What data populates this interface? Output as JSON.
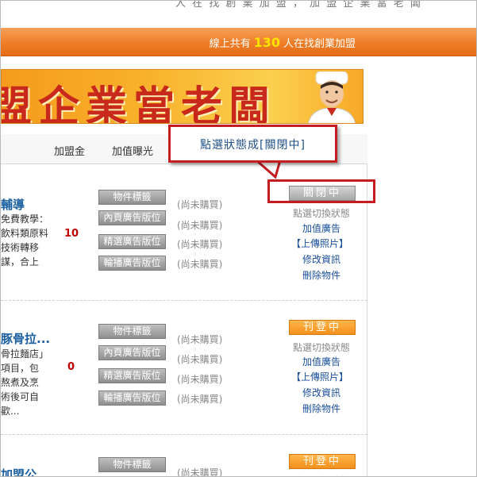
{
  "top_text": "人 在 找 創 業 加 盟 ， 加 盟 企 業 當 老 闆",
  "header": {
    "online_prefix": "線上共有",
    "online_count": "130",
    "online_suffix": "人在找創業加盟"
  },
  "banner": {
    "text": "盟企業當老闆"
  },
  "columns": [
    "加盟金",
    "加值曝光"
  ],
  "callout": {
    "text": "點選狀態成[關閉中]"
  },
  "ad_buttons": [
    "物件標籤",
    "內頁廣告版位",
    "精選廣告版位",
    "輪播廣告版位"
  ],
  "not_bought": "(尚未購買)",
  "actions": {
    "status_hint": "點選切換狀態",
    "add_ad": "加值廣告",
    "upload": "【上傳照片】",
    "edit": "修改資訊",
    "delete": "刪除物件"
  },
  "listings": [
    {
      "title": "輔導",
      "desc": [
        "免費教學：",
        "飲料類原料",
        "技術轉移",
        "謀，合上"
      ],
      "count": "10",
      "status": "關閉中"
    },
    {
      "title": "豚骨拉...",
      "desc": [
        "骨拉麵店」",
        "項目，包",
        "熬煮及烹",
        "術後可自",
        "歡..."
      ],
      "count": "0",
      "status": "刊登中"
    },
    {
      "title": "加盟公",
      "status": "刊登中"
    }
  ],
  "colors": {
    "orange": "#ee7d28",
    "red_callout": "#c41c20",
    "link": "#1a4f9a",
    "count_red": "#c00000"
  }
}
